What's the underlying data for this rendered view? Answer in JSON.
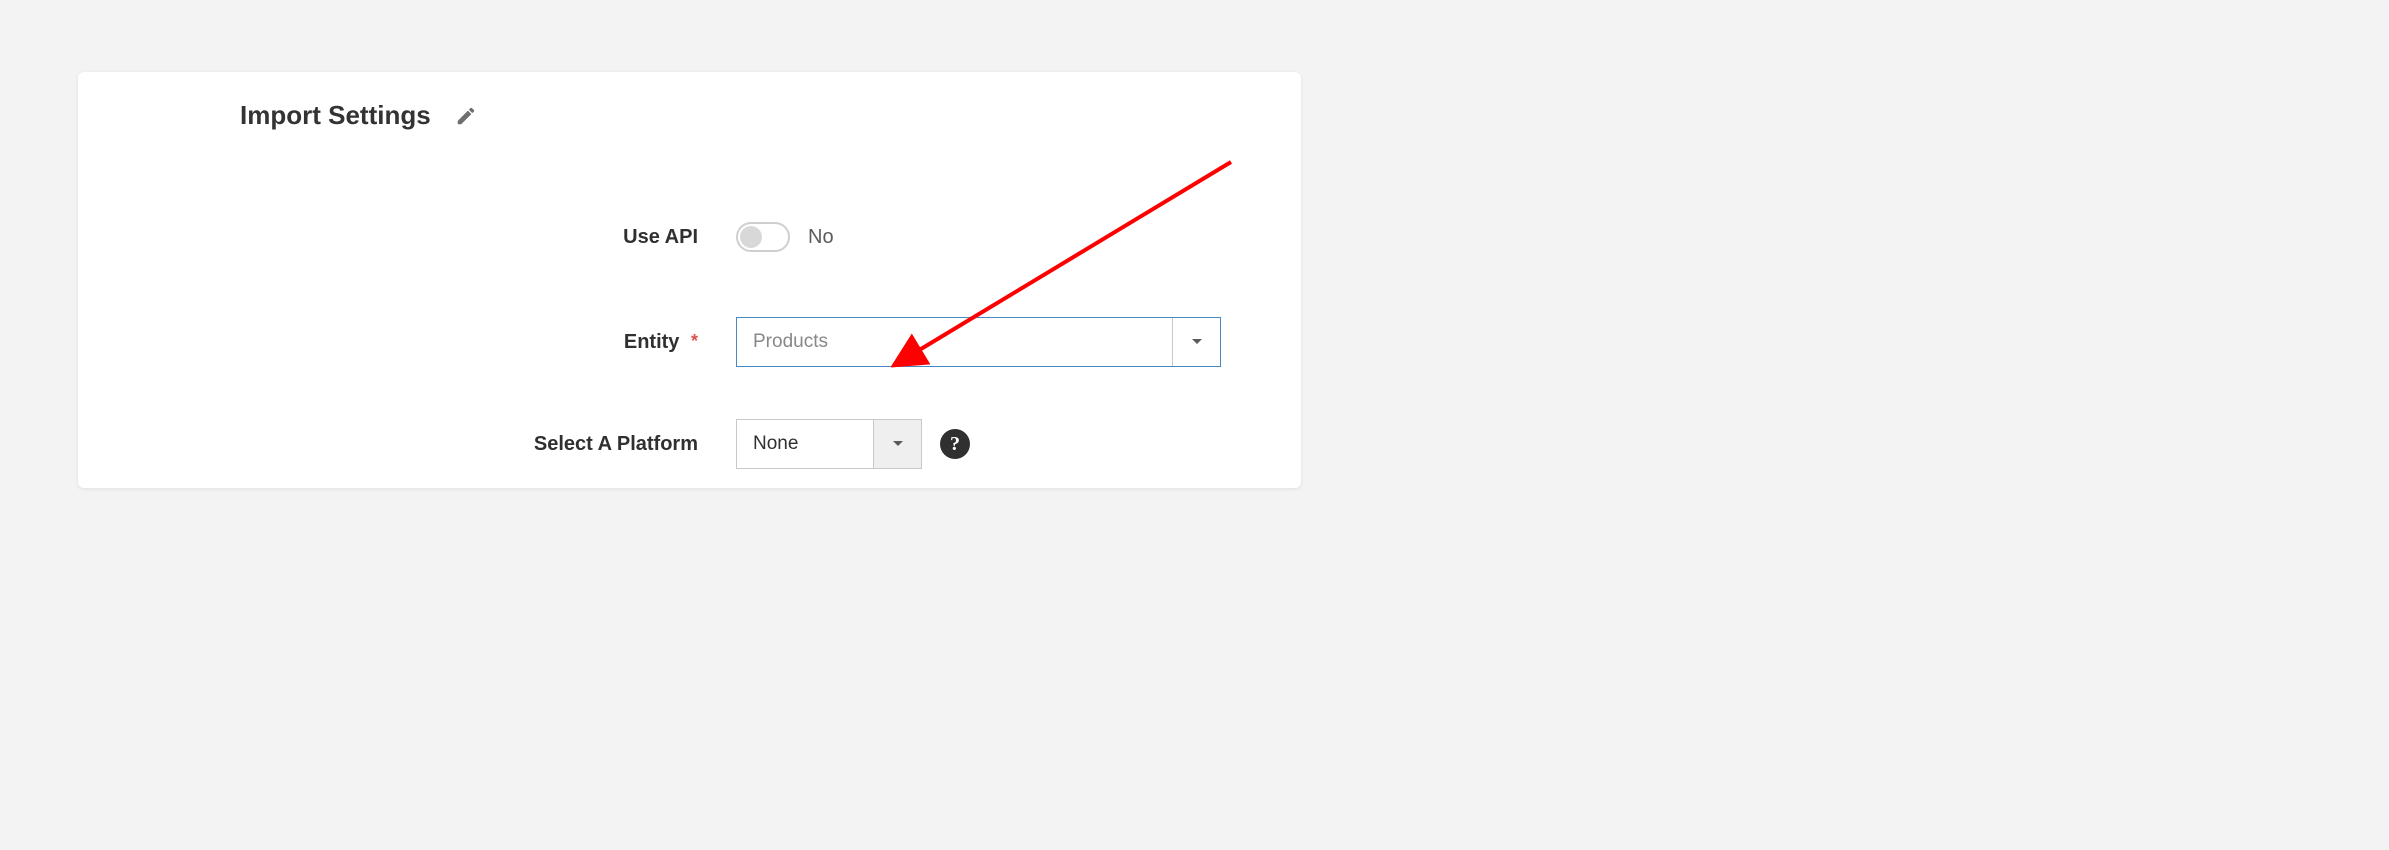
{
  "panel": {
    "title": "Import Settings"
  },
  "fields": {
    "use_api": {
      "label": "Use API",
      "value_text": "No"
    },
    "entity": {
      "label": "Entity",
      "required_marker": "*",
      "selected": "Products"
    },
    "platform": {
      "label": "Select A Platform",
      "selected": "None",
      "help_symbol": "?"
    }
  }
}
